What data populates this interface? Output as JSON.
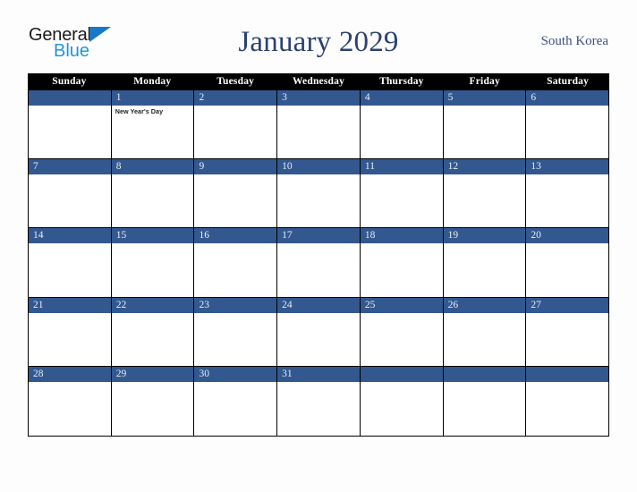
{
  "brand": {
    "name_part1": "General",
    "name_part2": "Blue",
    "triangle_color": "#1878c8",
    "blue_color": "#2196d8"
  },
  "header": {
    "title": "January 2029",
    "country": "South Korea",
    "title_color": "#2c4270"
  },
  "calendar": {
    "weekday_header_bg": "#000000",
    "date_band_color": "#32588f",
    "weekdays": [
      "Sunday",
      "Monday",
      "Tuesday",
      "Wednesday",
      "Thursday",
      "Friday",
      "Saturday"
    ],
    "weeks": [
      {
        "days": [
          {
            "date": "",
            "events": []
          },
          {
            "date": "1",
            "events": [
              "New Year's Day"
            ]
          },
          {
            "date": "2",
            "events": []
          },
          {
            "date": "3",
            "events": []
          },
          {
            "date": "4",
            "events": []
          },
          {
            "date": "5",
            "events": []
          },
          {
            "date": "6",
            "events": []
          }
        ]
      },
      {
        "days": [
          {
            "date": "7",
            "events": []
          },
          {
            "date": "8",
            "events": []
          },
          {
            "date": "9",
            "events": []
          },
          {
            "date": "10",
            "events": []
          },
          {
            "date": "11",
            "events": []
          },
          {
            "date": "12",
            "events": []
          },
          {
            "date": "13",
            "events": []
          }
        ]
      },
      {
        "days": [
          {
            "date": "14",
            "events": []
          },
          {
            "date": "15",
            "events": []
          },
          {
            "date": "16",
            "events": []
          },
          {
            "date": "17",
            "events": []
          },
          {
            "date": "18",
            "events": []
          },
          {
            "date": "19",
            "events": []
          },
          {
            "date": "20",
            "events": []
          }
        ]
      },
      {
        "days": [
          {
            "date": "21",
            "events": []
          },
          {
            "date": "22",
            "events": []
          },
          {
            "date": "23",
            "events": []
          },
          {
            "date": "24",
            "events": []
          },
          {
            "date": "25",
            "events": []
          },
          {
            "date": "26",
            "events": []
          },
          {
            "date": "27",
            "events": []
          }
        ]
      },
      {
        "days": [
          {
            "date": "28",
            "events": []
          },
          {
            "date": "29",
            "events": []
          },
          {
            "date": "30",
            "events": []
          },
          {
            "date": "31",
            "events": []
          },
          {
            "date": "",
            "events": []
          },
          {
            "date": "",
            "events": []
          },
          {
            "date": "",
            "events": []
          }
        ]
      }
    ]
  }
}
